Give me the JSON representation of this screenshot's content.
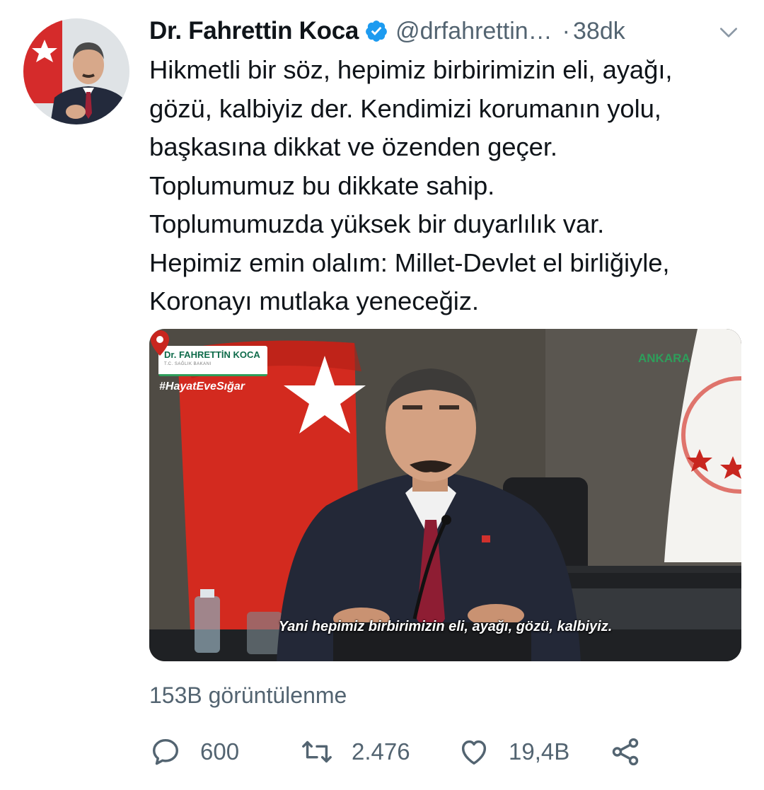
{
  "author": {
    "name": "Dr. Fahrettin Koca",
    "handle": "@drfahrettin…",
    "separator": "·",
    "time": "38dk"
  },
  "tweet_text": "Hikmetli bir söz, hepimiz birbirimizin eli, ayağı,\ngözü, kalbiyiz der. Kendimizi korumanın yolu,\nbaşkasına dikkat ve özenden geçer.\nToplumumuz bu dikkate sahip.\nToplumumuzda yüksek bir duyarlılık var.\nHepimiz emin olalım: Millet-Devlet el birliğiyle,\nKoronayı mutlaka yeneceğiz.",
  "media": {
    "lower_third_name": "Dr. FAHRETTİN KOCA",
    "lower_third_title": "T.C. SAĞLIK BAKANI",
    "hashtag": "#HayatEveSığar",
    "location": "ANKARA",
    "subtitle": "Yani hepimiz birbirimizin eli, ayağı, gözü, kalbiyiz."
  },
  "views": "153B görüntülenme",
  "actions": {
    "reply_count": "600",
    "retweet_count": "2.476",
    "like_count": "19,4B"
  },
  "icons": {
    "verified": "verified-badge-icon",
    "more": "chevron-down-icon",
    "reply": "reply-icon",
    "retweet": "retweet-icon",
    "like": "heart-icon",
    "share": "share-icon"
  },
  "colors": {
    "text": "#0f1419",
    "secondary": "#536471",
    "verified": "#1d9bf0"
  }
}
